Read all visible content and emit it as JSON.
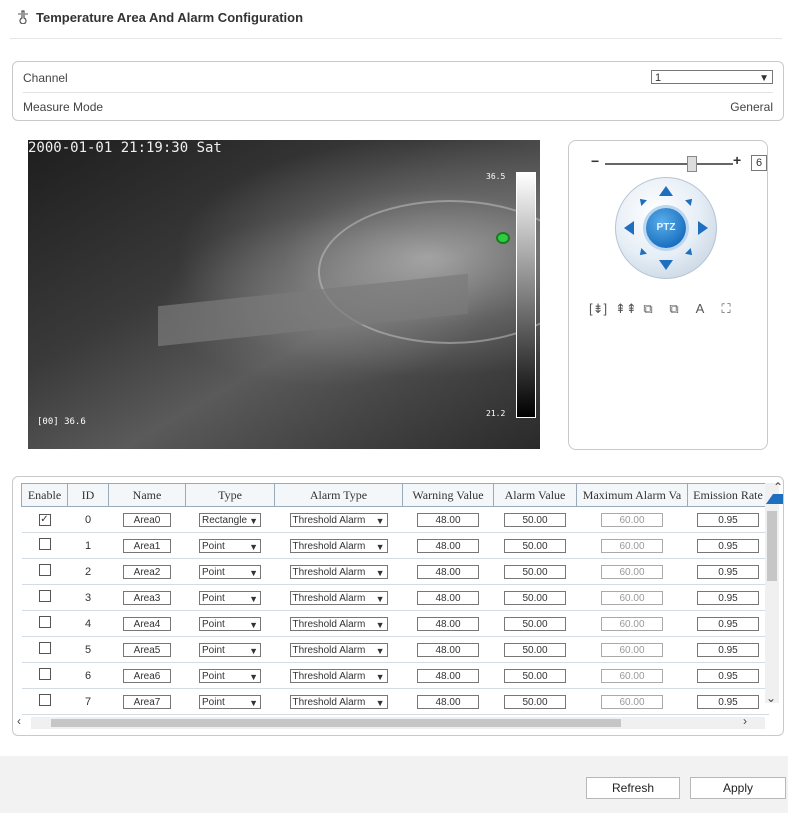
{
  "header": {
    "title": "Temperature Area And Alarm Configuration"
  },
  "channel": {
    "label": "Channel",
    "value": "1"
  },
  "measure_mode": {
    "label": "Measure Mode",
    "value": "General"
  },
  "video": {
    "timestamp": "2000-01-01 21:19:30 Sat",
    "scale_max": "36.5",
    "scale_min": "21.2",
    "point_reading": "[00] 36.6"
  },
  "ptz": {
    "zoom_minus": "−",
    "zoom_plus": "+",
    "zoom_value": "6",
    "center_label": "PTZ",
    "tool_icons": [
      "zoom-in-icon",
      "zoom-out-icon",
      "focus-near-icon",
      "focus-far-icon",
      "auto-focus-icon",
      "fit-icon"
    ],
    "tool_glyphs": [
      "[⇟]",
      "⇞⇞",
      "⧉",
      "⧉",
      "A",
      "⛶"
    ]
  },
  "table": {
    "headers": [
      "Enable",
      "ID",
      "Name",
      "Type",
      "Alarm Type",
      "Warning Value",
      "Alarm Value",
      "Maximum Alarm Va",
      "Emission Rate"
    ],
    "rows": [
      {
        "enabled": true,
        "id": "0",
        "name": "Area0",
        "type": "Rectangle",
        "alarm_type": "Threshold Alarm",
        "warning": "48.00",
        "alarm": "50.00",
        "max_alarm": "60.00",
        "emission": "0.95"
      },
      {
        "enabled": false,
        "id": "1",
        "name": "Area1",
        "type": "Point",
        "alarm_type": "Threshold Alarm",
        "warning": "48.00",
        "alarm": "50.00",
        "max_alarm": "60.00",
        "emission": "0.95"
      },
      {
        "enabled": false,
        "id": "2",
        "name": "Area2",
        "type": "Point",
        "alarm_type": "Threshold Alarm",
        "warning": "48.00",
        "alarm": "50.00",
        "max_alarm": "60.00",
        "emission": "0.95"
      },
      {
        "enabled": false,
        "id": "3",
        "name": "Area3",
        "type": "Point",
        "alarm_type": "Threshold Alarm",
        "warning": "48.00",
        "alarm": "50.00",
        "max_alarm": "60.00",
        "emission": "0.95"
      },
      {
        "enabled": false,
        "id": "4",
        "name": "Area4",
        "type": "Point",
        "alarm_type": "Threshold Alarm",
        "warning": "48.00",
        "alarm": "50.00",
        "max_alarm": "60.00",
        "emission": "0.95"
      },
      {
        "enabled": false,
        "id": "5",
        "name": "Area5",
        "type": "Point",
        "alarm_type": "Threshold Alarm",
        "warning": "48.00",
        "alarm": "50.00",
        "max_alarm": "60.00",
        "emission": "0.95"
      },
      {
        "enabled": false,
        "id": "6",
        "name": "Area6",
        "type": "Point",
        "alarm_type": "Threshold Alarm",
        "warning": "48.00",
        "alarm": "50.00",
        "max_alarm": "60.00",
        "emission": "0.95"
      },
      {
        "enabled": false,
        "id": "7",
        "name": "Area7",
        "type": "Point",
        "alarm_type": "Threshold Alarm",
        "warning": "48.00",
        "alarm": "50.00",
        "max_alarm": "60.00",
        "emission": "0.95"
      }
    ]
  },
  "buttons": {
    "refresh": "Refresh",
    "apply": "Apply"
  }
}
